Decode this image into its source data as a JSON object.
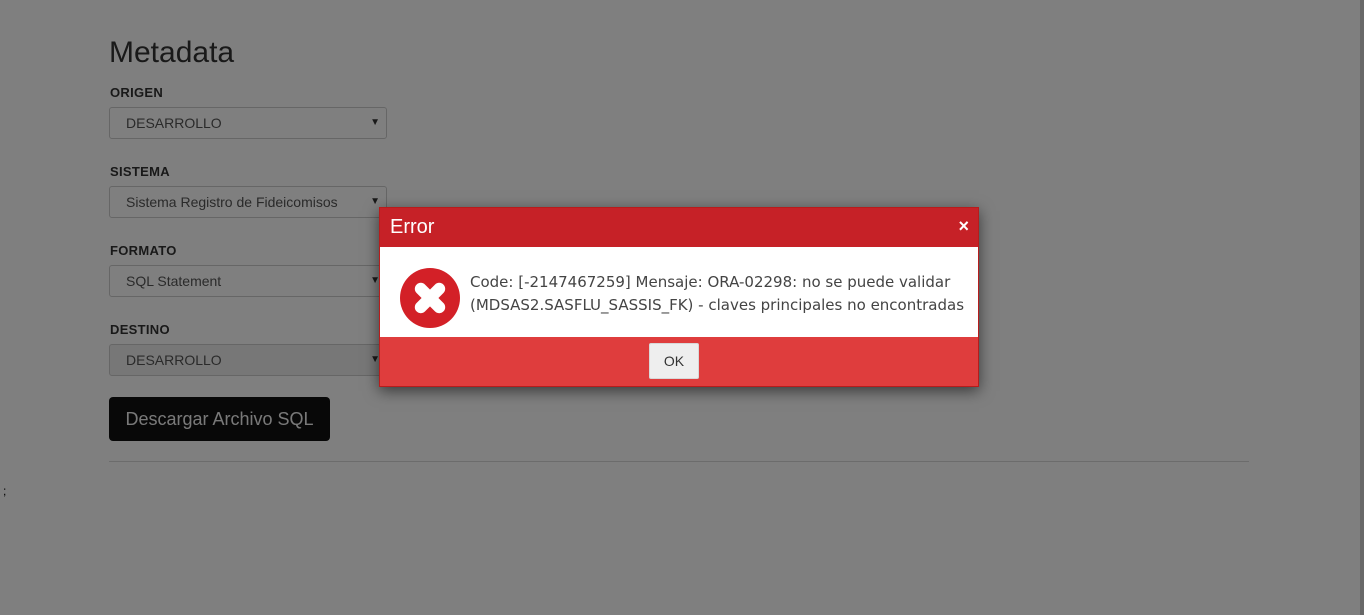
{
  "page": {
    "title": "Metadata",
    "stray_text": ";"
  },
  "form": {
    "origen": {
      "label": "ORIGEN",
      "value": "DESARROLLO"
    },
    "sistema": {
      "label": "SISTEMA",
      "value": "Sistema Registro de Fideicomisos"
    },
    "formato": {
      "label": "FORMATO",
      "value": "SQL Statement"
    },
    "destino": {
      "label": "DESTINO",
      "value": "DESARROLLO"
    },
    "download_label": "Descargar Archivo SQL"
  },
  "dialog": {
    "title": "Error",
    "close_glyph": "×",
    "message_line1": "Code: [-2147467259] Mensaje: ORA-02298: no se puede validar",
    "message_line2": "(MDSAS2.SASFLU_SASSIS_FK) - claves principales no encontradas",
    "ok_label": "OK",
    "icon": "error-x-circle-icon"
  },
  "colors": {
    "dialog_header": "#c62127",
    "dialog_footer": "#df3d3d",
    "icon_red": "#d32027",
    "overlay": "rgba(0,0,0,0.5)"
  }
}
